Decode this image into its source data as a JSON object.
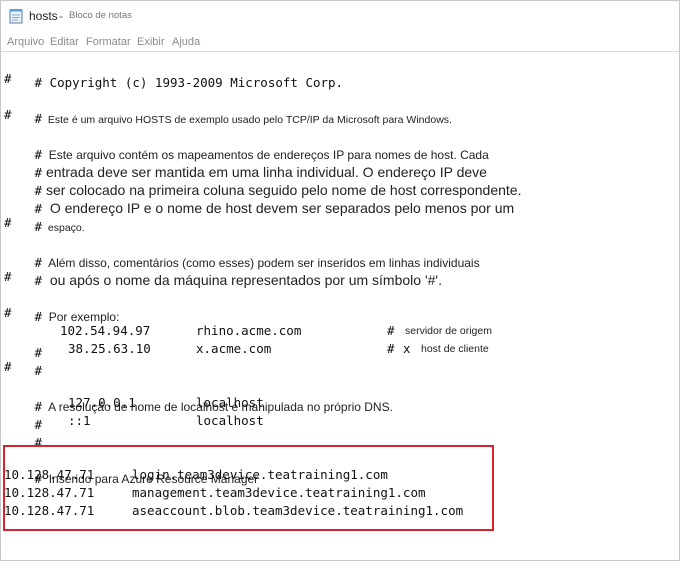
{
  "window": {
    "file_name": "hosts",
    "title_separator": "-",
    "app_name": "Bloco de notas",
    "icon": "notepad-icon"
  },
  "menu": [
    "Arquivo",
    "Editar",
    "Formatar",
    "Exibir",
    "Ajuda"
  ],
  "document": {
    "hash": "#",
    "copyright": "Copyright (c) 1993-2009 Microsoft Corp.",
    "intro": "Este é um arquivo HOSTS de exemplo usado pelo TCP/IP da Microsoft para Windows.",
    "para": [
      "Este arquivo contém os mapeamentos de endereços IP para nomes de host. Cada",
      "entrada deve ser mantida em uma linha individual. O endereço IP deve",
      "ser colocado na primeira coluna seguido pelo nome de host correspondente.",
      "O endereço IP e o nome de host devem ser separados pelo menos por um",
      "espaço."
    ],
    "comments": [
      "Além disso, comentários (como esses) podem ser inseridos em linhas individuais",
      "ou após o nome da máquina representados por um símbolo '#'."
    ],
    "example_label": "Por exemplo:",
    "examples": [
      {
        "ip": "102.54.94.97",
        "host": "rhino.acme.com",
        "hash": "#",
        "extra": "",
        "comment": "servidor de origem"
      },
      {
        "ip": "38.25.63.10",
        "host": "x.acme.com",
        "hash": "#",
        "extra": "x",
        "comment": "host de cliente"
      }
    ],
    "localhost_note": "A resolução de nome de localhost é manipulada no próprio DNS.",
    "localhost": [
      {
        "ip": "127.0.0.1",
        "host": "localhost"
      },
      {
        "ip": "::1",
        "host": "localhost"
      }
    ],
    "azure_comment": "Inserido para Azure Resource Manager",
    "azure_entries": [
      {
        "ip": "10.128.47.71",
        "host": "login.team3device.teatraining1.com"
      },
      {
        "ip": "10.128.47.71",
        "host": "management.team3device.teatraining1.com"
      },
      {
        "ip": "10.128.47.71",
        "host": "aseaccount.blob.team3device.teatraining1.com"
      }
    ],
    "highlight_color": "#d9232e"
  }
}
